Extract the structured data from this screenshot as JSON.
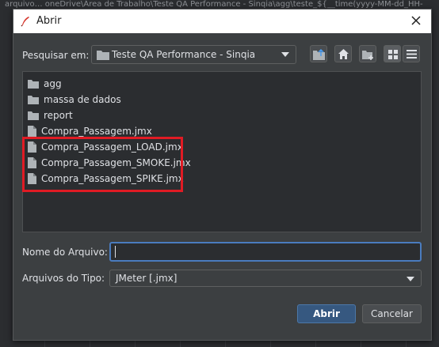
{
  "background": {
    "window_title": "arquivo… oneDrive\\Área de Trabalho\\Teste QA Performance - Sinqia\\agg\\teste_${__time(yyyy-MM-dd_HH-"
  },
  "dialog": {
    "title": "Abrir",
    "icons": {
      "app": "jmeter-feather-icon",
      "close": "close-icon"
    }
  },
  "look_in": {
    "label": "Pesquisar em:",
    "value": "Teste QA Performance - Sinqia"
  },
  "toolbar": {
    "buttons": [
      "up-one-level-icon",
      "home-icon",
      "new-folder-icon",
      "list-view-icon",
      "details-view-icon"
    ],
    "selected": "list-view-icon"
  },
  "files": [
    {
      "name": "agg",
      "type": "folder"
    },
    {
      "name": "massa de dados",
      "type": "folder"
    },
    {
      "name": "report",
      "type": "folder"
    },
    {
      "name": "Compra_Passagem.jmx",
      "type": "file"
    },
    {
      "name": "Compra_Passagem_LOAD.jmx",
      "type": "file"
    },
    {
      "name": "Compra_Passagem_SMOKE.jmx",
      "type": "file"
    },
    {
      "name": "Compra_Passagem_SPIKE.jmx",
      "type": "file"
    }
  ],
  "filename": {
    "label": "Nome do Arquivo:",
    "value": ""
  },
  "filetype": {
    "label": "Arquivos do Tipo:",
    "value": "JMeter [.jmx]"
  },
  "buttons": {
    "open": "Abrir",
    "cancel": "Cancelar"
  },
  "colors": {
    "highlight_box": "#e01b24",
    "primary_button": "#365880",
    "dialog_bg": "#3c3f41"
  }
}
